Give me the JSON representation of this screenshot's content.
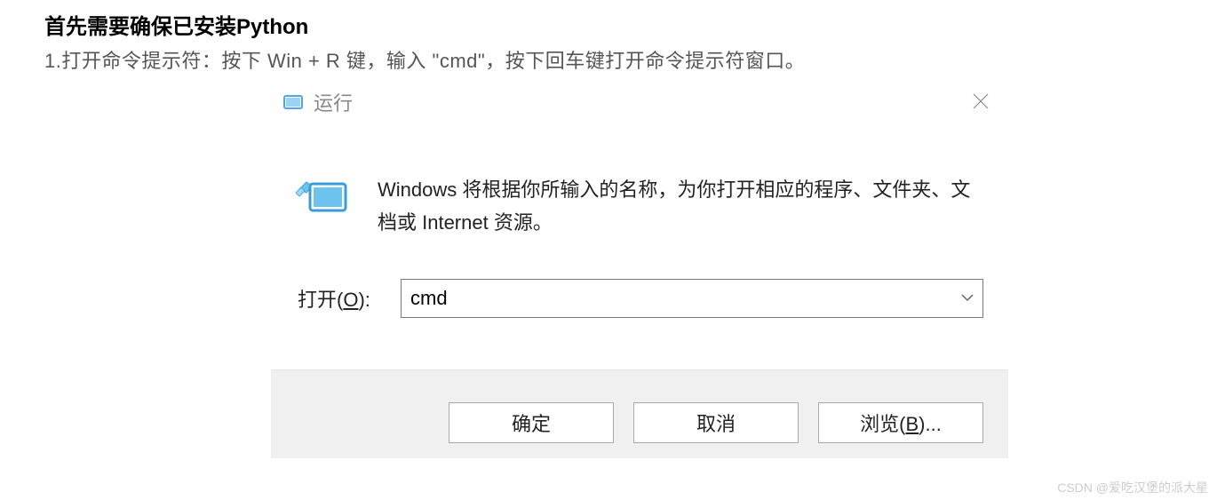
{
  "article": {
    "heading": "首先需要确保已安装Python",
    "instruction": "1.打开命令提示符：按下 Win + R 键，输入 \"cmd\"，按下回车键打开命令提示符窗口。"
  },
  "dialog": {
    "title": "运行",
    "description": "Windows 将根据你所输入的名称，为你打开相应的程序、文件夹、文档或 Internet 资源。",
    "open_label_prefix": "打开(",
    "open_label_key": "O",
    "open_label_suffix": "):",
    "input_value": "cmd",
    "buttons": {
      "ok": "确定",
      "cancel": "取消",
      "browse_prefix": "浏览(",
      "browse_key": "B",
      "browse_suffix": ")..."
    }
  },
  "watermark": "CSDN @爱吃汉堡的派大星"
}
